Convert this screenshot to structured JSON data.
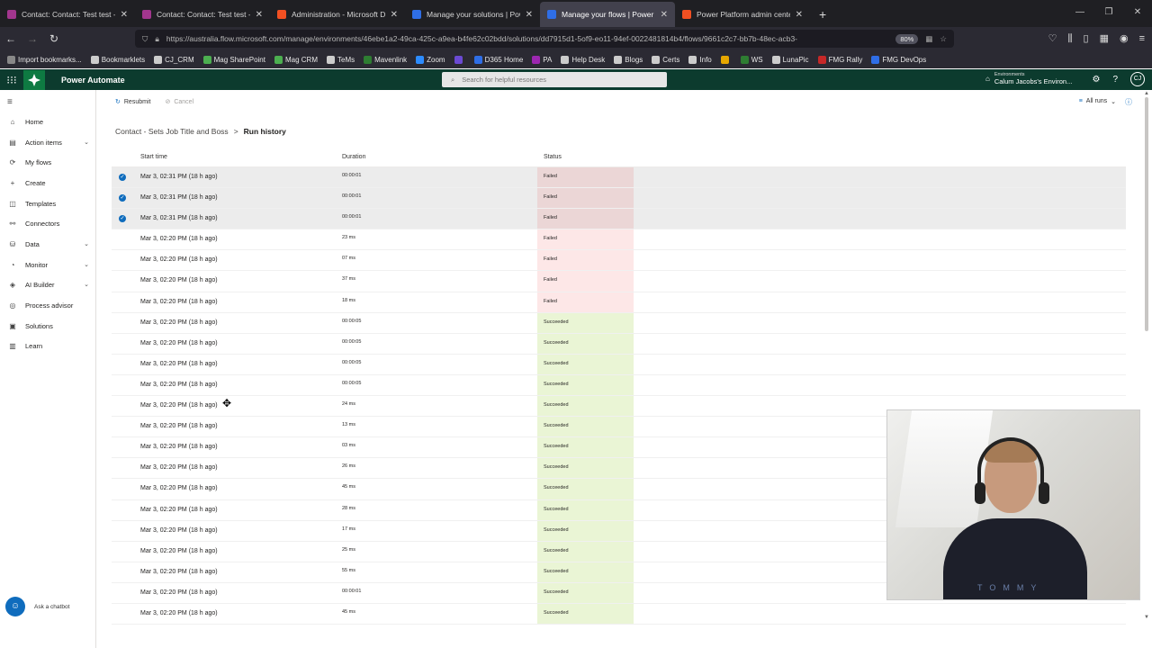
{
  "browser": {
    "tabs": [
      {
        "title": "Contact: Contact: Test test - Po",
        "color": "#a2368e",
        "active": false
      },
      {
        "title": "Contact: Contact: Test test - Po",
        "color": "#a2368e",
        "active": false
      },
      {
        "title": "Administration - Microsoft Dyn",
        "color": "#f25022",
        "active": false
      },
      {
        "title": "Manage your solutions | Power",
        "color": "#2f6ee6",
        "active": false
      },
      {
        "title": "Manage your flows | Power Aut",
        "color": "#2f6ee6",
        "active": true
      },
      {
        "title": "Power Platform admin center",
        "color": "#f25022",
        "active": false
      }
    ],
    "url": "https://australia.flow.microsoft.com/manage/environments/46ebe1a2-49ca-425c-a9ea-b4fe62c02bdd/solutions/dd7915d1-5of9-eo11-94ef-0022481814b4/flows/9661c2c7-bb7b-48ec-acb3-",
    "zoom": "80%",
    "bookmarks": [
      "Import bookmarks...",
      "Bookmarklets",
      "CJ_CRM",
      "Mag SharePoint",
      "Mag CRM",
      "TeMs",
      "Mavenlink",
      "Zoom",
      "",
      "D365 Home",
      "PA",
      "Help Desk",
      "Blogs",
      "Certs",
      "Info",
      "",
      "WS",
      "LunaPic",
      "FMG Rally",
      "FMG DevOps"
    ]
  },
  "app": {
    "name": "Power Automate",
    "search_placeholder": "Search for helpful resources",
    "env_label": "Environments",
    "env_name": "Calum Jacobs's Environ...",
    "avatar": "CJ"
  },
  "sidebar": {
    "items": [
      {
        "label": "Home",
        "icon": "home-icon",
        "glyph": "⌂",
        "chevron": false
      },
      {
        "label": "Action items",
        "icon": "clipboard-icon",
        "glyph": "▤",
        "chevron": true
      },
      {
        "label": "My flows",
        "icon": "flow-icon",
        "glyph": "⟳",
        "chevron": false
      },
      {
        "label": "Create",
        "icon": "plus-icon",
        "glyph": "+",
        "chevron": false
      },
      {
        "label": "Templates",
        "icon": "template-icon",
        "glyph": "◫",
        "chevron": false
      },
      {
        "label": "Connectors",
        "icon": "connector-icon",
        "glyph": "⚯",
        "chevron": false
      },
      {
        "label": "Data",
        "icon": "data-icon",
        "glyph": "⛁",
        "chevron": true
      },
      {
        "label": "Monitor",
        "icon": "monitor-icon",
        "glyph": "◔",
        "chevron": true
      },
      {
        "label": "AI Builder",
        "icon": "ai-icon",
        "glyph": "◈",
        "chevron": true
      },
      {
        "label": "Process advisor",
        "icon": "process-icon",
        "glyph": "◎",
        "chevron": false
      },
      {
        "label": "Solutions",
        "icon": "solutions-icon",
        "glyph": "▣",
        "chevron": false
      },
      {
        "label": "Learn",
        "icon": "book-icon",
        "glyph": "▥",
        "chevron": false
      }
    ],
    "chatbot_label": "Ask a chatbot"
  },
  "command_bar": {
    "resubmit": "Resubmit",
    "cancel": "Cancel",
    "filter": "All runs"
  },
  "breadcrumb": {
    "parent": "Contact - Sets Job Title and Boss",
    "separator": ">",
    "current": "Run history"
  },
  "table": {
    "headers": {
      "start_time": "Start time",
      "duration": "Duration",
      "status": "Status"
    },
    "rows": [
      {
        "start": "Mar 3, 02:31 PM (18 h ago)",
        "duration": "00:00:01",
        "status": "Failed",
        "selected": true
      },
      {
        "start": "Mar 3, 02:31 PM (18 h ago)",
        "duration": "00:00:01",
        "status": "Failed",
        "selected": true
      },
      {
        "start": "Mar 3, 02:31 PM (18 h ago)",
        "duration": "00:00:01",
        "status": "Failed",
        "selected": true
      },
      {
        "start": "Mar 3, 02:20 PM (18 h ago)",
        "duration": "23 ms",
        "status": "Failed",
        "selected": false
      },
      {
        "start": "Mar 3, 02:20 PM (18 h ago)",
        "duration": "07 ms",
        "status": "Failed",
        "selected": false
      },
      {
        "start": "Mar 3, 02:20 PM (18 h ago)",
        "duration": "37 ms",
        "status": "Failed",
        "selected": false
      },
      {
        "start": "Mar 3, 02:20 PM (18 h ago)",
        "duration": "18 ms",
        "status": "Failed",
        "selected": false
      },
      {
        "start": "Mar 3, 02:20 PM (18 h ago)",
        "duration": "00:00:05",
        "status": "Succeeded",
        "selected": false
      },
      {
        "start": "Mar 3, 02:20 PM (18 h ago)",
        "duration": "00:00:05",
        "status": "Succeeded",
        "selected": false
      },
      {
        "start": "Mar 3, 02:20 PM (18 h ago)",
        "duration": "00:00:05",
        "status": "Succeeded",
        "selected": false
      },
      {
        "start": "Mar 3, 02:20 PM (18 h ago)",
        "duration": "00:00:05",
        "status": "Succeeded",
        "selected": false
      },
      {
        "start": "Mar 3, 02:20 PM (18 h ago)",
        "duration": "24 ms",
        "status": "Succeeded",
        "selected": false
      },
      {
        "start": "Mar 3, 02:20 PM (18 h ago)",
        "duration": "13 ms",
        "status": "Succeeded",
        "selected": false
      },
      {
        "start": "Mar 3, 02:20 PM (18 h ago)",
        "duration": "03 ms",
        "status": "Succeeded",
        "selected": false
      },
      {
        "start": "Mar 3, 02:20 PM (18 h ago)",
        "duration": "26 ms",
        "status": "Succeeded",
        "selected": false
      },
      {
        "start": "Mar 3, 02:20 PM (18 h ago)",
        "duration": "45 ms",
        "status": "Succeeded",
        "selected": false
      },
      {
        "start": "Mar 3, 02:20 PM (18 h ago)",
        "duration": "28 ms",
        "status": "Succeeded",
        "selected": false
      },
      {
        "start": "Mar 3, 02:20 PM (18 h ago)",
        "duration": "17 ms",
        "status": "Succeeded",
        "selected": false
      },
      {
        "start": "Mar 3, 02:20 PM (18 h ago)",
        "duration": "25 ms",
        "status": "Succeeded",
        "selected": false
      },
      {
        "start": "Mar 3, 02:20 PM (18 h ago)",
        "duration": "55 ms",
        "status": "Succeeded",
        "selected": false
      },
      {
        "start": "Mar 3, 02:20 PM (18 h ago)",
        "duration": "00:00:01",
        "status": "Succeeded",
        "selected": false
      },
      {
        "start": "Mar 3, 02:20 PM (18 h ago)",
        "duration": "45 ms",
        "status": "Succeeded",
        "selected": false
      }
    ]
  },
  "webcam": {
    "shirt_text": "TOMMY"
  },
  "colors": {
    "app_header": "#0c3b2e",
    "failed_bg": "#fde7e7",
    "succeeded_bg": "#eaf5d5",
    "accent": "#0f6cbd"
  }
}
